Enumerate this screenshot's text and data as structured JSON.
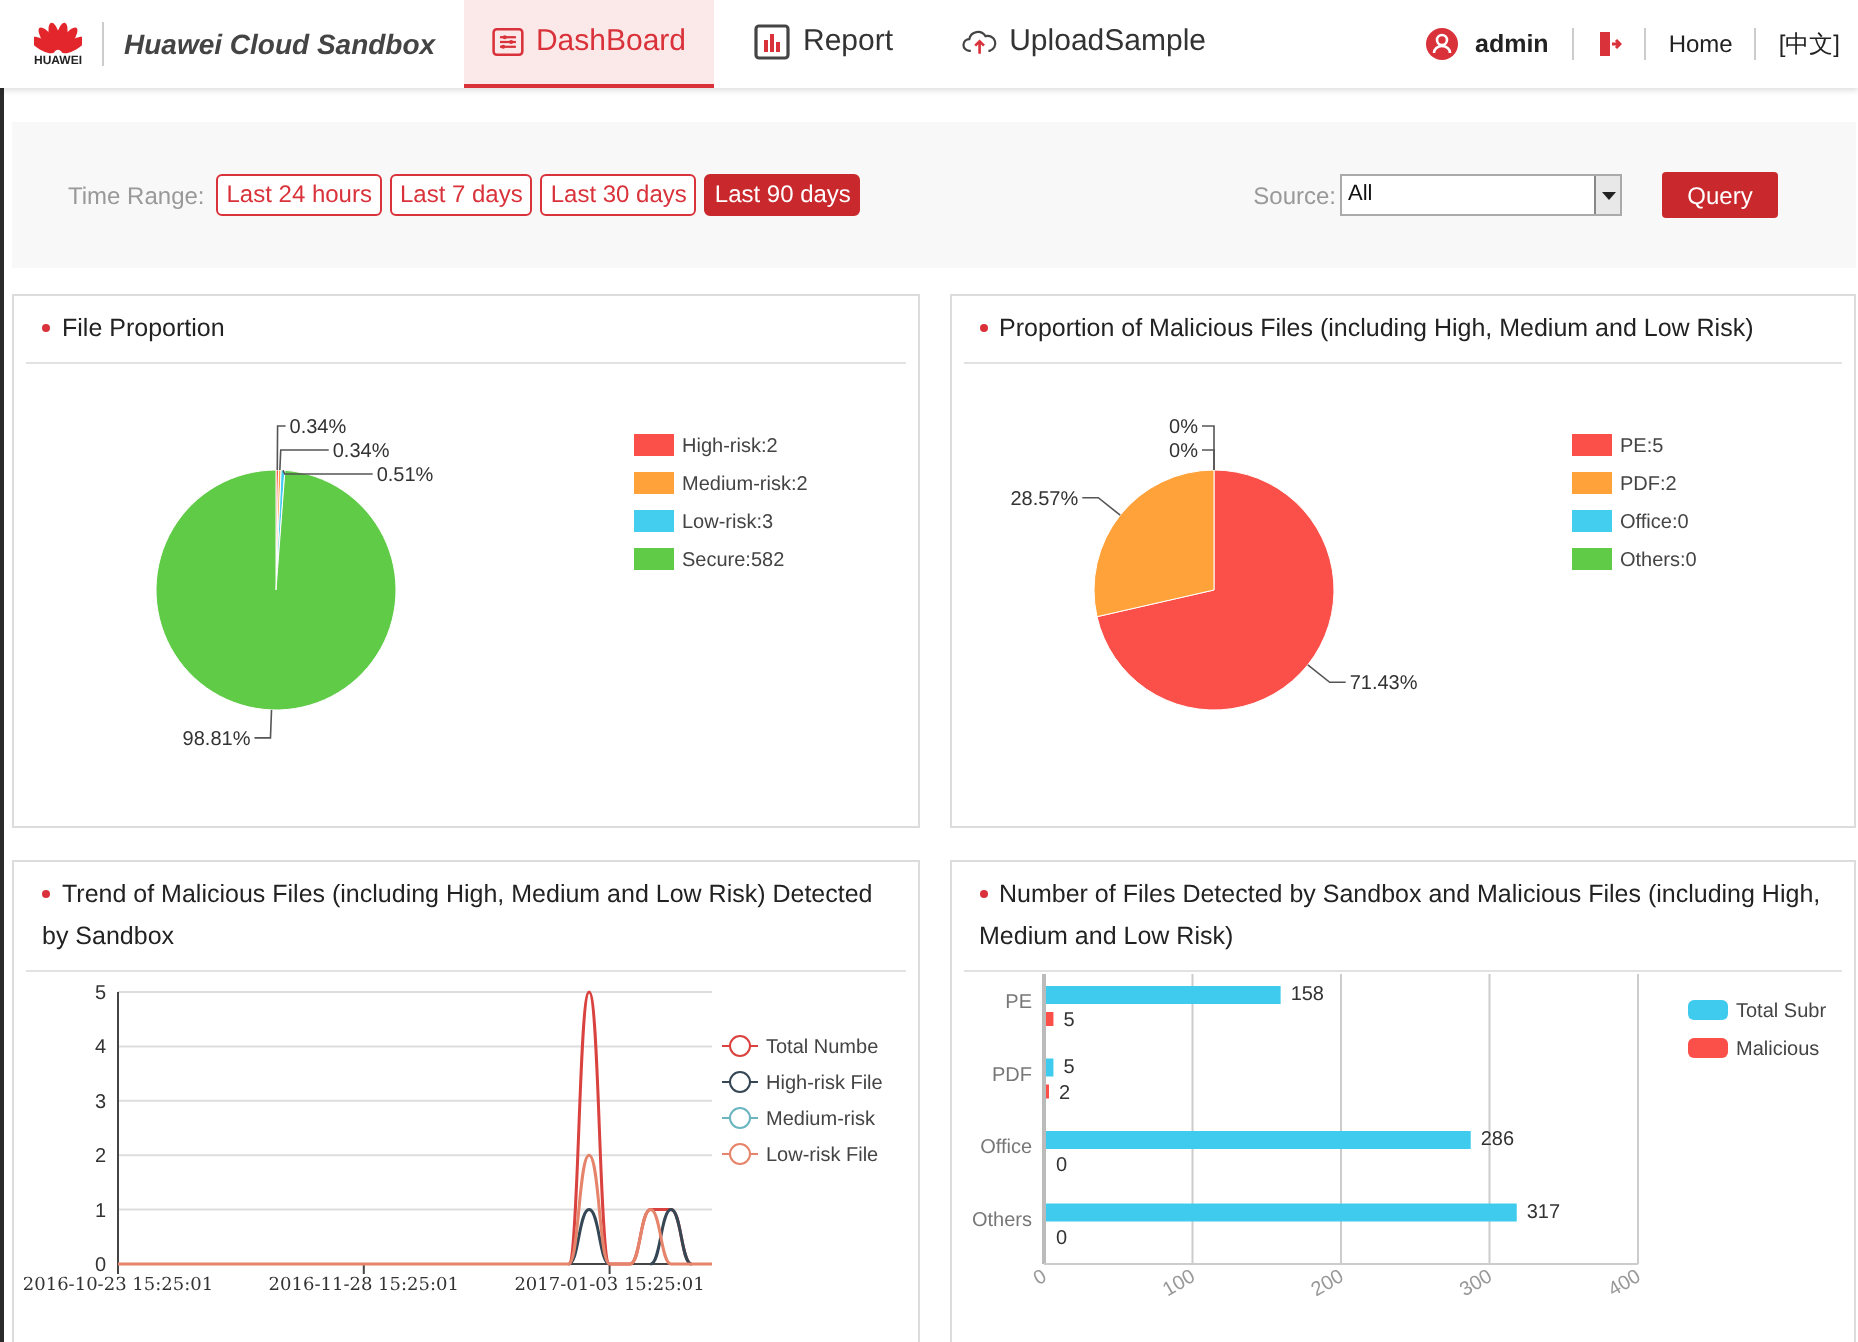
{
  "header": {
    "logo_text": "HUAWEI",
    "app_title": "Huawei Cloud Sandbox",
    "nav": [
      {
        "label": "DashBoard",
        "kind": "dashboard",
        "selected": true
      },
      {
        "label": "Report",
        "kind": "report",
        "selected": false
      },
      {
        "label": "UploadSample",
        "kind": "upload",
        "selected": false
      }
    ],
    "user": "admin",
    "links": [
      "Home",
      "[中文]"
    ]
  },
  "filters": {
    "time_range_label": "Time Range:",
    "ranges": [
      {
        "label": "Last 24 hours",
        "selected": false
      },
      {
        "label": "Last 7 days",
        "selected": false
      },
      {
        "label": "Last 30 days",
        "selected": false
      },
      {
        "label": "Last 90 days",
        "selected": true
      }
    ],
    "source_label": "Source:",
    "source_value": "All",
    "query_button": "Query"
  },
  "panels": [
    {
      "title": "File Proportion",
      "chart_data": {
        "type": "pie",
        "categories": [
          "High-risk:2",
          "Medium-risk:2",
          "Low-risk:3",
          "Secure:582"
        ],
        "values": [
          0.34,
          0.34,
          0.51,
          98.81
        ],
        "legend": true,
        "colors": [
          "#fb5049",
          "#ffa23a",
          "#43cdee",
          "#5fcb47"
        ],
        "value_labels": [
          "0.34%",
          "0.34%",
          "0.51%",
          "98.81%"
        ]
      }
    },
    {
      "title": "Proportion of Malicious Files (including High, Medium and Low Risk)",
      "chart_data": {
        "type": "pie",
        "categories": [
          "PE:5",
          "PDF:2",
          "Office:0",
          "Others:0"
        ],
        "values": [
          71.43,
          28.57,
          0,
          0
        ],
        "legend": true,
        "colors": [
          "#fb5049",
          "#ffa23a",
          "#43cdee",
          "#5fcb47"
        ],
        "value_labels": [
          "71.43%",
          "28.57%",
          "0%",
          "0%"
        ]
      }
    },
    {
      "title": "Trend of Malicious Files (including High, Medium and Low Risk) Detected by Sandbox",
      "chart_data": {
        "type": "line",
        "categories": [
          "2016-10-23 15:25:01",
          null,
          null,
          null,
          null,
          null,
          null,
          null,
          null,
          null,
          null,
          null,
          "2016-11-28 15:25:01",
          null,
          null,
          null,
          null,
          null,
          null,
          null,
          null,
          null,
          null,
          null,
          "2017-01-03 15:25:01",
          null,
          null,
          null,
          null,
          null
        ],
        "ylim": [
          0,
          5
        ],
        "grid": true,
        "legend": true,
        "yticks": [
          0,
          1,
          2,
          3,
          4,
          5
        ],
        "series": [
          {
            "name": "Total Numbe",
            "color": "#d9423e",
            "values": [
              null,
              null,
              null,
              null,
              null,
              null,
              null,
              null,
              null,
              null,
              null,
              null,
              null,
              null,
              null,
              null,
              null,
              null,
              null,
              null,
              null,
              null,
              0,
              5,
              0,
              0,
              1,
              1,
              0,
              null
            ]
          },
          {
            "name": "High-risk File",
            "color": "#354654",
            "values": [
              null,
              null,
              null,
              null,
              null,
              null,
              null,
              null,
              null,
              null,
              null,
              null,
              null,
              null,
              null,
              null,
              null,
              null,
              null,
              null,
              null,
              null,
              0,
              1,
              0,
              null,
              0,
              1,
              0,
              null
            ]
          },
          {
            "name": "Medium-risk",
            "color": "#6bb5c0",
            "values": [
              null,
              null,
              null,
              null,
              null,
              null,
              null,
              null,
              null,
              null,
              null,
              null,
              null,
              null,
              null,
              null,
              null,
              null,
              null,
              null,
              null,
              null,
              null,
              null,
              null,
              null,
              null,
              null,
              null,
              null
            ]
          },
          {
            "name": "Low-risk File",
            "color": "#e5846a",
            "values": [
              0,
              0,
              0,
              0,
              0,
              0,
              0,
              0,
              0,
              0,
              0,
              0,
              0,
              0,
              0,
              0,
              0,
              0,
              0,
              0,
              0,
              0,
              0,
              2,
              0,
              0,
              1,
              0,
              0,
              0
            ]
          }
        ]
      }
    },
    {
      "title": "Number of Files Detected by Sandbox and Malicious Files (including High, Medium and Low Risk)",
      "chart_data": {
        "type": "bar",
        "orientation": "horizontal",
        "categories": [
          "PE",
          "PDF",
          "Office",
          "Others"
        ],
        "xlim": [
          0,
          400
        ],
        "xticks": [
          0,
          100,
          200,
          300,
          400
        ],
        "data_labels": true,
        "grid": true,
        "legend": true,
        "series": [
          {
            "name": "Total Subr",
            "color": "#3fcbee",
            "values": [
              158,
              5,
              286,
              317
            ]
          },
          {
            "name": "Malicious",
            "color": "#fb5049",
            "values": [
              5,
              2,
              0,
              0
            ]
          }
        ]
      }
    }
  ]
}
